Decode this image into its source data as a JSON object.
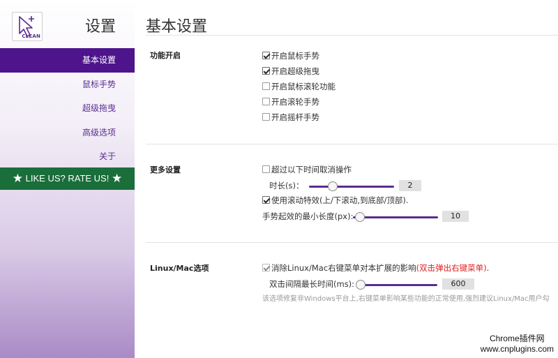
{
  "sidebar": {
    "logo_text": "CLEAN",
    "title": "设置",
    "items": [
      {
        "label": "基本设置",
        "active": true
      },
      {
        "label": "鼠标手势",
        "active": false
      },
      {
        "label": "超级拖曳",
        "active": false
      },
      {
        "label": "高级选项",
        "active": false
      },
      {
        "label": "关于",
        "active": false
      }
    ],
    "rate_label": "LIKE US? RATE US!"
  },
  "main": {
    "title": "基本设置",
    "sections": {
      "features": {
        "label": "功能开启",
        "options": [
          {
            "label": "开启鼠标手势",
            "checked": true
          },
          {
            "label": "开启超级拖曳",
            "checked": true
          },
          {
            "label": "开启鼠标滚轮功能",
            "checked": false
          },
          {
            "label": "开启滚轮手势",
            "checked": false
          },
          {
            "label": "开启摇杆手势",
            "checked": false
          }
        ]
      },
      "more": {
        "label": "更多设置",
        "timeout_option": {
          "label": "超过以下时间取消操作",
          "checked": false
        },
        "duration_label": "时长(s)：",
        "duration_value": "2",
        "duration_fraction": 0.28,
        "smooth_option": {
          "label": "使用滚动特效(上/下滚动,到底部/顶部).",
          "checked": true
        },
        "min_length_label": "手势起效的最小长度(px):",
        "min_length_value": "10",
        "min_length_fraction": 0.08
      },
      "linux": {
        "label": "Linux/Mac选项",
        "menu_option": {
          "label": "消除Linux/Mac右键菜单对本扩展的影响",
          "highlight": "(双击弹出右键菜单)",
          "suffix": ".",
          "checked": true
        },
        "dbl_label": "双击间隔最长时间(ms):",
        "dbl_value": "600",
        "dbl_fraction": 0.05,
        "note": "该选项修复非Windows平台上,右键菜单影响某些功能的正常使用,强烈建议Linux/Mac用户勾"
      }
    }
  },
  "watermark": {
    "line1": "Chrome插件网",
    "line2": "www.cnplugins.com"
  },
  "colors": {
    "accent": "#4e148c",
    "rate_bg": "#1a6e3a",
    "highlight": "#e02020"
  }
}
